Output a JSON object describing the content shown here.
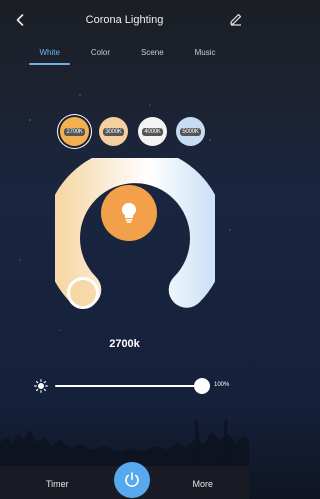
{
  "header": {
    "title": "Corona Lighting",
    "back_icon": "chevron-left-icon",
    "edit_icon": "pencil-icon"
  },
  "tabs": [
    {
      "label": "White",
      "active": true
    },
    {
      "label": "Color",
      "active": false
    },
    {
      "label": "Scene",
      "active": false
    },
    {
      "label": "Music",
      "active": false
    }
  ],
  "presets": [
    {
      "label": "2700K",
      "color": "#f4b04e",
      "selected": true
    },
    {
      "label": "3000K",
      "color": "#f6cfa0",
      "selected": false
    },
    {
      "label": "4000K",
      "color": "#f3f3f5",
      "selected": false
    },
    {
      "label": "5000K",
      "color": "#c6dcf3",
      "selected": false
    }
  ],
  "temperature": {
    "value_label": "2700k",
    "center_icon": "lightbulb-icon",
    "center_color": "#f3a04a"
  },
  "brightness": {
    "icon": "sun-icon",
    "percent_label": "100%",
    "level": 1.0
  },
  "bottom_bar": {
    "timer_label": "Timer",
    "more_label": "More",
    "power_icon": "power-icon",
    "power_color": "#55a9ec"
  },
  "colors": {
    "accent": "#6cb2ea"
  }
}
